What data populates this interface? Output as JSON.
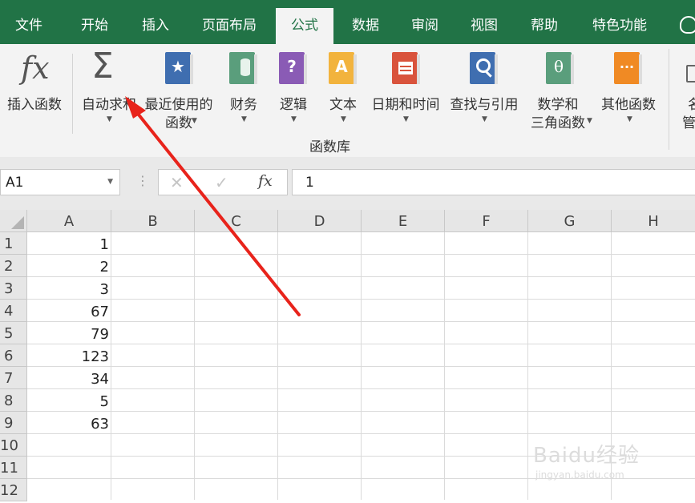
{
  "tabs": [
    "文件",
    "开始",
    "插入",
    "页面布局",
    "公式",
    "数据",
    "审阅",
    "视图",
    "帮助",
    "特色功能"
  ],
  "active_tab": "公式",
  "ribbon": {
    "insert_function": "插入函数",
    "autosum": "自动求和",
    "recent_l1": "最近使用的",
    "recent_l2": "函数",
    "financial": "财务",
    "logical": "逻辑",
    "text": "文本",
    "datetime": "日期和时间",
    "lookup": "查找与引用",
    "math_l1": "数学和",
    "math_l2": "三角函数",
    "other": "其他函数",
    "group_label": "函数库",
    "fx_glyph": "fx",
    "sigma_glyph": "Σ",
    "star_glyph": "★",
    "question_glyph": "?",
    "a_glyph": "A",
    "theta_glyph": "θ",
    "dots_glyph": "···",
    "right_clip_1": "名",
    "right_clip_2": "管"
  },
  "colors": {
    "excel_green": "#217346",
    "recent_book": "#3f6eb0",
    "financial_book": "#5a9e7c",
    "logical_book": "#8a5bb5",
    "text_book": "#f2b33d",
    "datetime_book": "#d9533c",
    "lookup_book": "#3f6eb0",
    "math_book": "#5a9e7c",
    "other_book": "#f08a24",
    "arrow": "#e8231b"
  },
  "formula_bar": {
    "name_box": "A1",
    "fx": "fx",
    "cancel": "✕",
    "enter": "✓",
    "content": "1"
  },
  "sheet": {
    "columns": [
      "A",
      "B",
      "C",
      "D",
      "E",
      "F",
      "G",
      "H"
    ],
    "rows": [
      "1",
      "2",
      "3",
      "4",
      "5",
      "6",
      "7",
      "8",
      "9",
      "10",
      "11",
      "12"
    ],
    "col_a_values": [
      "1",
      "2",
      "3",
      "67",
      "79",
      "123",
      "34",
      "5",
      "63"
    ]
  },
  "watermark": {
    "main": "Baidu经验",
    "sub": "jingyan.baidu.com"
  }
}
